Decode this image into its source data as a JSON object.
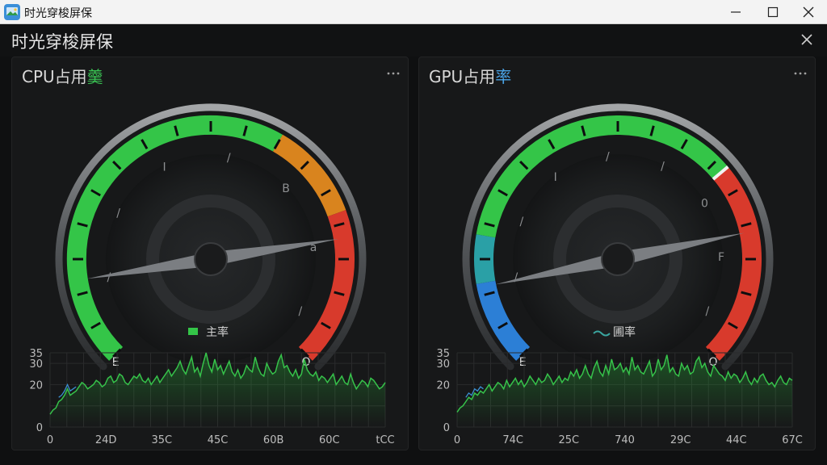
{
  "window": {
    "title": "时光穿梭屏保"
  },
  "app": {
    "title": "时光穿梭屏保"
  },
  "colors": {
    "green": "#34c548",
    "orange": "#d9841e",
    "red": "#d83a2c",
    "blue": "#2c7fd6"
  },
  "cpu": {
    "title_prefix": "CPU占用",
    "title_suffix": "羹",
    "legend": "主率",
    "dial_labels": [
      "/",
      "/",
      "I",
      "/",
      "B",
      "a",
      "/"
    ],
    "end_labels": [
      "E",
      "O"
    ],
    "needle_value": 0.8,
    "chart_data": {
      "type": "line",
      "y_ticks": [
        "35",
        "30",
        "20",
        "0"
      ],
      "x_ticks": [
        "0",
        "24D",
        "35C",
        "45C",
        "60B",
        "60C",
        "tCC"
      ],
      "series": [
        {
          "values": [
            6,
            8,
            9,
            12,
            13,
            15,
            18,
            15,
            16,
            17,
            19,
            21,
            20,
            18,
            19,
            20,
            22,
            21,
            19,
            20,
            23,
            24,
            21,
            22,
            25,
            24,
            21,
            20,
            22,
            24,
            23,
            25,
            22,
            21,
            23,
            20,
            22,
            24,
            21,
            23,
            25,
            27,
            24,
            26,
            28,
            31,
            27,
            25,
            29,
            33,
            26,
            28,
            24,
            30,
            35,
            29,
            26,
            32,
            27,
            29,
            25,
            28,
            31,
            26,
            24,
            27,
            23,
            25,
            29,
            27,
            26,
            33,
            28,
            25,
            24,
            30,
            27,
            25,
            26,
            31,
            34,
            28,
            29,
            26,
            24,
            27,
            23,
            25,
            32,
            27,
            25,
            24,
            26,
            22,
            24,
            23,
            21,
            23,
            25,
            20,
            22,
            24,
            21,
            20,
            25,
            21,
            18,
            20,
            22,
            21,
            19,
            23,
            22,
            20,
            18,
            19,
            21
          ]
        }
      ]
    }
  },
  "gpu": {
    "title_prefix": "GPU占用",
    "title_suffix": "率",
    "legend": "圃率",
    "dial_labels": [
      "/",
      "/",
      "I",
      "/",
      "/",
      "0",
      "F",
      "/"
    ],
    "end_labels": [
      "E",
      "O"
    ],
    "needle_value": 0.79,
    "chart_data": {
      "type": "line",
      "y_ticks": [
        "35",
        "30",
        "20",
        "0"
      ],
      "x_ticks": [
        "0",
        "74C",
        "25C",
        "740",
        "29C",
        "44C",
        "67C"
      ],
      "series": [
        {
          "values": [
            7,
            9,
            10,
            12,
            14,
            13,
            16,
            15,
            17,
            16,
            18,
            20,
            17,
            19,
            21,
            20,
            18,
            22,
            19,
            21,
            23,
            20,
            22,
            19,
            21,
            24,
            22,
            20,
            23,
            21,
            22,
            25,
            23,
            20,
            22,
            24,
            21,
            23,
            22,
            26,
            24,
            27,
            23,
            25,
            29,
            25,
            23,
            28,
            31,
            26,
            24,
            29,
            25,
            32,
            27,
            28,
            30,
            26,
            28,
            25,
            33,
            27,
            29,
            26,
            25,
            28,
            31,
            24,
            26,
            32,
            27,
            29,
            34,
            26,
            28,
            25,
            24,
            30,
            27,
            29,
            25,
            26,
            31,
            33,
            28,
            30,
            26,
            24,
            29,
            27,
            25,
            24,
            22,
            26,
            23,
            25,
            24,
            21,
            23,
            26,
            22,
            20,
            23,
            21,
            24,
            25,
            22,
            20,
            21,
            19,
            22,
            24,
            21,
            20,
            23,
            22
          ]
        }
      ]
    }
  }
}
